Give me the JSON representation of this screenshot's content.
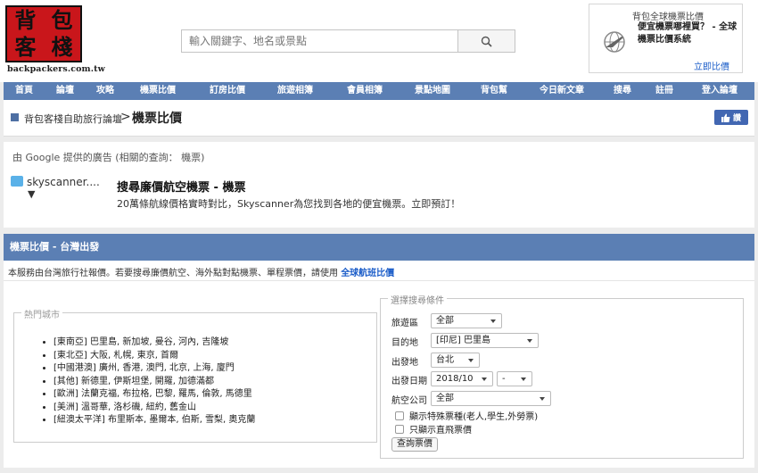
{
  "header": {
    "logo_chars": [
      "背",
      "包",
      "客",
      "棧"
    ],
    "logo_domain": "backpackers.com.tw",
    "search_placeholder": "輸入關鍵字、地名或景點",
    "ad": {
      "title": "背包全球機票比價",
      "text": "便宜機票哪裡買？ - 全球機票比價系統",
      "link": "立即比價"
    }
  },
  "nav": {
    "items": [
      "首頁",
      "論壇",
      "攻略",
      "機票比價",
      "訂房比價",
      "旅遊相簿",
      "會員相簿",
      "景點地圖",
      "背包幫",
      "今日新文章",
      "搜尋",
      "註冊",
      "登入論壇"
    ]
  },
  "breadcrumb": {
    "home": "背包客棧自助旅行論壇",
    "separator": ">",
    "current": "機票比價",
    "fb_like": "讚"
  },
  "google_ad": {
    "header": "由 Google 提供的廣告 (相關的查詢： 機票)",
    "advertiser": "skyscanner....",
    "arrow": "▼",
    "headline": "搜尋廉價航空機票 - 機票",
    "description": "20萬條航線價格實時對比，Skyscanner為您找到各地的便宜機票。立即預訂！"
  },
  "main": {
    "title": "機票比價 - 台灣出發",
    "intro_text": "本服務由台灣旅行社報價。若要搜尋廉價航空、海外點對點機票、單程票價，請使用",
    "intro_link": "全球航班比價",
    "hot_cities": {
      "legend": "熱門城市",
      "items": [
        "[東南亞] 巴里島, 新加坡, 曼谷, 河內, 吉隆坡",
        "[東北亞] 大阪, 札幌, 東京, 首爾",
        "[中國港澳] 廣州, 香港, 澳門, 北京, 上海, 廈門",
        "[其他] 新德里, 伊斯坦堡, 開羅, 加德滿都",
        "[歐洲] 法蘭克福, 布拉格, 巴黎, 羅馬, 倫敦, 馬德里",
        "[美洲] 溫哥華, 洛杉磯, 紐約, 舊金山",
        "[紐澳太平洋] 布里斯本, 墨爾本, 伯斯, 雪梨, 奧克蘭"
      ]
    },
    "search_form": {
      "legend": "選擇搜尋條件",
      "region_label": "旅遊區",
      "region_value": "全部",
      "destination_label": "目的地",
      "destination_value": "[印尼] 巴里島",
      "departure_label": "出發地",
      "departure_value": "台北",
      "date_label": "出發日期",
      "date_month": "2018/10",
      "date_day": "-",
      "airline_label": "航空公司",
      "airline_value": "全部",
      "special_fare": "顯示特殊票種(老人,學生,外勞票)",
      "direct_only": "只顯示直飛票價",
      "submit": "查詢票價"
    }
  },
  "colors": {
    "nav_bg": "#5b7fb4",
    "logo_red": "#c9161b",
    "link_blue": "#1a5cc8",
    "fb_blue": "#4267b2"
  }
}
